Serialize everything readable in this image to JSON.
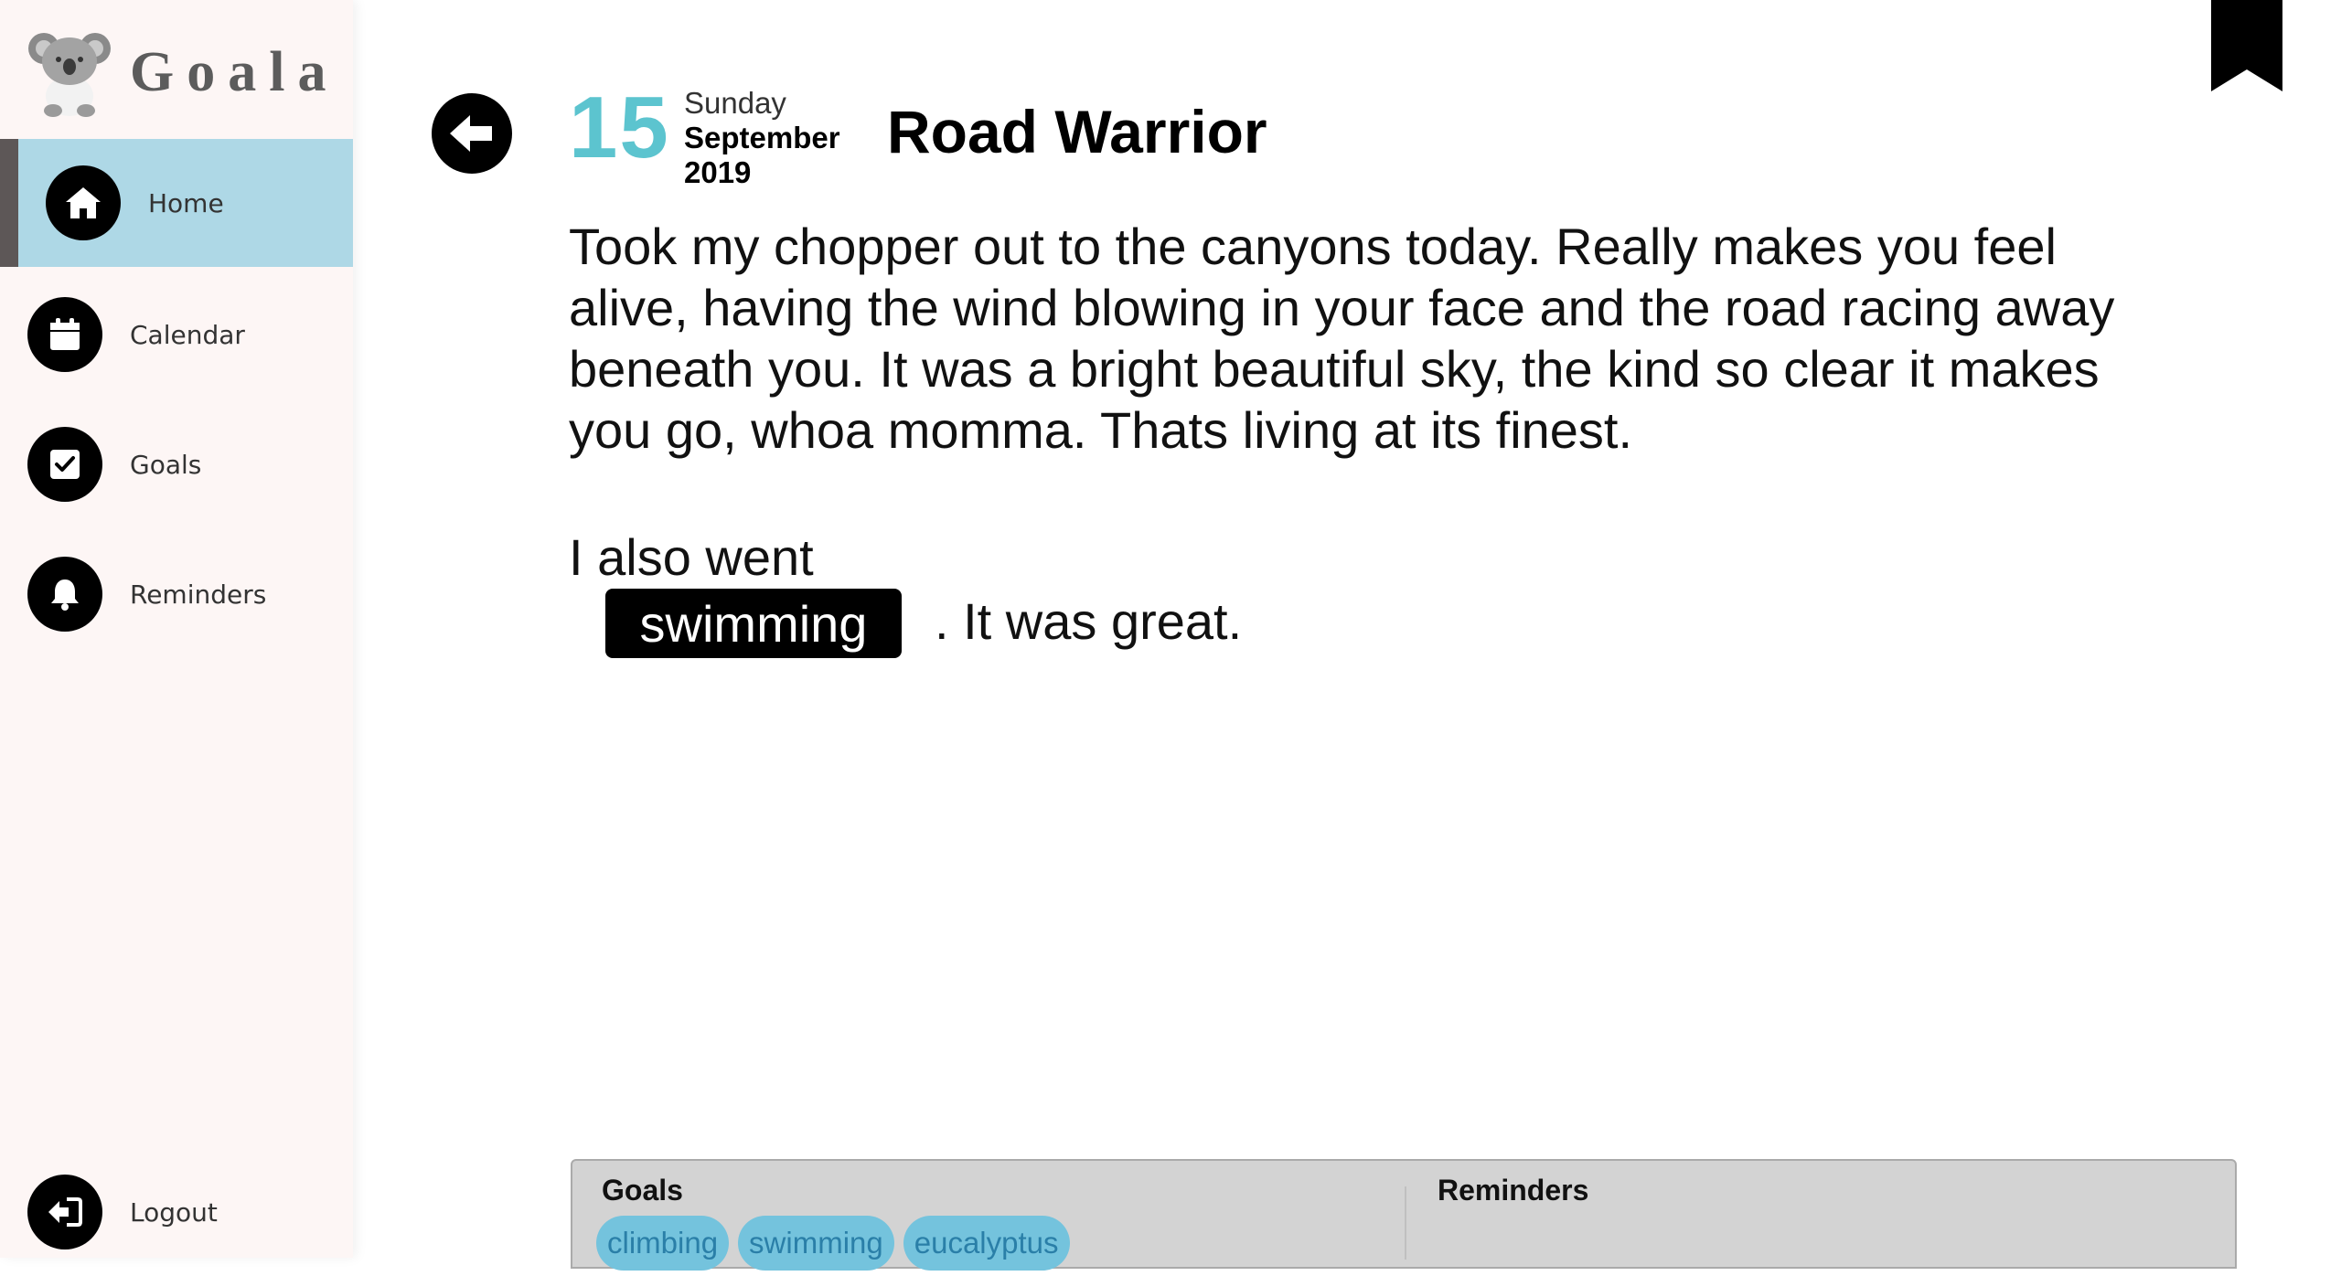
{
  "app": {
    "name": "Goala"
  },
  "sidebar": {
    "items": [
      {
        "label": "Home",
        "icon": "home-icon",
        "active": true
      },
      {
        "label": "Calendar",
        "icon": "calendar-icon",
        "active": false
      },
      {
        "label": "Goals",
        "icon": "checkbox-icon",
        "active": false
      },
      {
        "label": "Reminders",
        "icon": "bell-icon",
        "active": false
      }
    ],
    "logout_label": "Logout"
  },
  "entry": {
    "day_number": "15",
    "weekday": "Sunday",
    "month": "September",
    "year": "2019",
    "title": "Road Warrior",
    "body": "Took my chopper out to the canyons today. Really makes you feel alive, having the wind blowing in your face and the road racing away beneath you. It was a bright beautiful sky, the kind so clear it makes you go, whoa momma. Thats living at its finest.",
    "line2_prefix": "I also went",
    "inline_tag": "swimming",
    "line2_suffix": ". It was great."
  },
  "panel": {
    "goals_heading": "Goals",
    "reminders_heading": "Reminders",
    "goal_tags": [
      "climbing",
      "swimming",
      "eucalyptus"
    ]
  },
  "colors": {
    "accent_teal": "#5cc4cf",
    "active_nav_bg": "#aed8e6",
    "sidebar_bg": "#fdf6f5",
    "chip_bg": "#74c3dd",
    "panel_bg": "#d3d3d3"
  }
}
